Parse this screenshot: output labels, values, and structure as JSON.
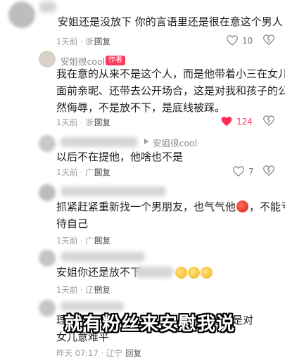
{
  "comments": [
    {
      "text": "安姐还是没放下 你的言语里还是很在意这个男人",
      "meta": "1天前 · 浙江",
      "reply": "回复",
      "likes": "10"
    },
    {
      "username": "安姐很cool",
      "badge": "作者",
      "lines": [
        "我在意的从来不是这个人，而是他带着小三在女儿",
        "面前亲昵、还带去公开场合，这是对我和孩子的公",
        "然侮辱，不是放不下，是底线被踩。"
      ],
      "meta": "1天前 · 浙江",
      "reply": "回复",
      "likes": "124"
    },
    {
      "reply_to": "安姐很cool",
      "text": "以后不在提他，他啥也不是",
      "meta": "1天前 · 广东",
      "reply": "回复",
      "likes": "7"
    },
    {
      "line1_a": "抓紧赶紧重新找一个男朋友，也气气他",
      "line1_b": "，不能亏",
      "line2": "待自己",
      "meta": "1天前 · 广东",
      "reply": "回复"
    },
    {
      "text": "安姐你还是放不下",
      "meta": "1天前 · 辽宁",
      "reply": "回复"
    },
    {
      "line1_a": "理",
      "line1_b": "意，是对",
      "line2": "女儿意难平",
      "meta": "昨天 07:17 · 辽宁",
      "reply": "回复"
    }
  ],
  "overlay_caption": "就有粉丝来安慰我说",
  "colors": {
    "like_red": "#ff2c55",
    "badge": "#ff3b5c"
  }
}
